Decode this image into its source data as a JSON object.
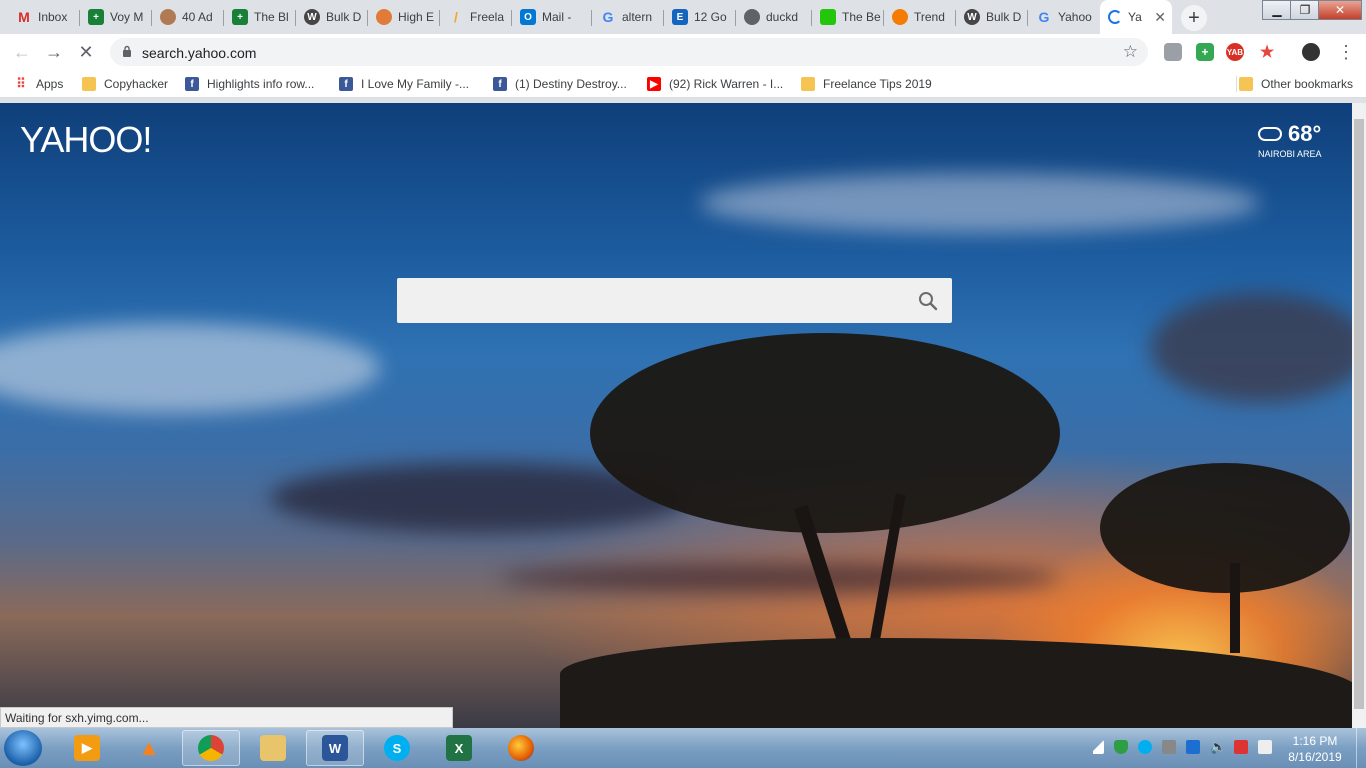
{
  "browser": {
    "tabs": [
      {
        "label": "Inbox",
        "icon": "gmail-icon",
        "color": "#d93025",
        "glyph": "M"
      },
      {
        "label": "Voy M",
        "icon": "sheets-icon",
        "color": "#188038",
        "glyph": "+"
      },
      {
        "label": "40 Ad",
        "icon": "avatar-icon",
        "color": "#b07b54",
        "glyph": ""
      },
      {
        "label": "The Bl",
        "icon": "sheets-icon",
        "color": "#188038",
        "glyph": "+"
      },
      {
        "label": "Bulk D",
        "icon": "wordpress-icon",
        "color": "#464646",
        "glyph": "W"
      },
      {
        "label": "High E",
        "icon": "basketball-icon",
        "color": "#e07b39",
        "glyph": ""
      },
      {
        "label": "Freela",
        "icon": "freelancer-icon",
        "color": "#f4a62a",
        "glyph": "/"
      },
      {
        "label": "Mail -",
        "icon": "outlook-icon",
        "color": "#0078d4",
        "glyph": "O"
      },
      {
        "label": "altern",
        "icon": "google-icon",
        "color": "#4285f4",
        "glyph": "G"
      },
      {
        "label": "12 Go",
        "icon": "site-icon",
        "color": "#1565c0",
        "glyph": "E"
      },
      {
        "label": "duckd",
        "icon": "globe-icon",
        "color": "#5f6368",
        "glyph": ""
      },
      {
        "label": "The Be",
        "icon": "green-icon",
        "color": "#24c60b",
        "glyph": ""
      },
      {
        "label": "Trend",
        "icon": "trend-icon",
        "color": "#f57c00",
        "glyph": ""
      },
      {
        "label": "Bulk D",
        "icon": "wordpress-icon",
        "color": "#464646",
        "glyph": "W"
      },
      {
        "label": "Yahoo",
        "icon": "google-icon",
        "color": "#4285f4",
        "glyph": "G"
      },
      {
        "label": "Ya",
        "icon": "loading-icon",
        "color": "#1a73e8",
        "glyph": "",
        "active": true
      }
    ],
    "url": "search.yahoo.com",
    "bookmarks": [
      {
        "label": "Apps",
        "type": "apps"
      },
      {
        "label": "Copyhacker",
        "type": "folder"
      },
      {
        "label": "Highlights info row...",
        "type": "fb"
      },
      {
        "label": "I Love My Family -...",
        "type": "fb"
      },
      {
        "label": "(1) Destiny Destroy...",
        "type": "fb"
      },
      {
        "label": "(92) Rick Warren - I...",
        "type": "yt"
      },
      {
        "label": "Freelance Tips 2019",
        "type": "folder"
      }
    ],
    "other_bookmarks": "Other bookmarks",
    "status_text": "Waiting for sxh.yimg.com..."
  },
  "page": {
    "logo": "YAHOO!",
    "weather": {
      "temp": "68°",
      "area": "NAIROBI AREA"
    },
    "search_placeholder": ""
  },
  "taskbar": {
    "time": "1:16 PM",
    "date": "8/16/2019",
    "extensions": [
      "YAB"
    ]
  }
}
